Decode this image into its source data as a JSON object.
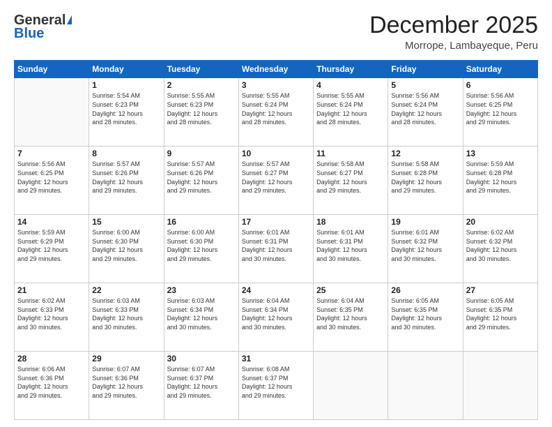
{
  "header": {
    "logo_general": "General",
    "logo_blue": "Blue",
    "title": "December 2025",
    "subtitle": "Morrope, Lambayeque, Peru"
  },
  "days_of_week": [
    "Sunday",
    "Monday",
    "Tuesday",
    "Wednesday",
    "Thursday",
    "Friday",
    "Saturday"
  ],
  "weeks": [
    [
      {
        "day": "",
        "info": ""
      },
      {
        "day": "1",
        "info": "Sunrise: 5:54 AM\nSunset: 6:23 PM\nDaylight: 12 hours\nand 28 minutes."
      },
      {
        "day": "2",
        "info": "Sunrise: 5:55 AM\nSunset: 6:23 PM\nDaylight: 12 hours\nand 28 minutes."
      },
      {
        "day": "3",
        "info": "Sunrise: 5:55 AM\nSunset: 6:24 PM\nDaylight: 12 hours\nand 28 minutes."
      },
      {
        "day": "4",
        "info": "Sunrise: 5:55 AM\nSunset: 6:24 PM\nDaylight: 12 hours\nand 28 minutes."
      },
      {
        "day": "5",
        "info": "Sunrise: 5:56 AM\nSunset: 6:24 PM\nDaylight: 12 hours\nand 28 minutes."
      },
      {
        "day": "6",
        "info": "Sunrise: 5:56 AM\nSunset: 6:25 PM\nDaylight: 12 hours\nand 29 minutes."
      }
    ],
    [
      {
        "day": "7",
        "info": "Sunrise: 5:56 AM\nSunset: 6:25 PM\nDaylight: 12 hours\nand 29 minutes."
      },
      {
        "day": "8",
        "info": "Sunrise: 5:57 AM\nSunset: 6:26 PM\nDaylight: 12 hours\nand 29 minutes."
      },
      {
        "day": "9",
        "info": "Sunrise: 5:57 AM\nSunset: 6:26 PM\nDaylight: 12 hours\nand 29 minutes."
      },
      {
        "day": "10",
        "info": "Sunrise: 5:57 AM\nSunset: 6:27 PM\nDaylight: 12 hours\nand 29 minutes."
      },
      {
        "day": "11",
        "info": "Sunrise: 5:58 AM\nSunset: 6:27 PM\nDaylight: 12 hours\nand 29 minutes."
      },
      {
        "day": "12",
        "info": "Sunrise: 5:58 AM\nSunset: 6:28 PM\nDaylight: 12 hours\nand 29 minutes."
      },
      {
        "day": "13",
        "info": "Sunrise: 5:59 AM\nSunset: 6:28 PM\nDaylight: 12 hours\nand 29 minutes."
      }
    ],
    [
      {
        "day": "14",
        "info": "Sunrise: 5:59 AM\nSunset: 6:29 PM\nDaylight: 12 hours\nand 29 minutes."
      },
      {
        "day": "15",
        "info": "Sunrise: 6:00 AM\nSunset: 6:30 PM\nDaylight: 12 hours\nand 29 minutes."
      },
      {
        "day": "16",
        "info": "Sunrise: 6:00 AM\nSunset: 6:30 PM\nDaylight: 12 hours\nand 29 minutes."
      },
      {
        "day": "17",
        "info": "Sunrise: 6:01 AM\nSunset: 6:31 PM\nDaylight: 12 hours\nand 30 minutes."
      },
      {
        "day": "18",
        "info": "Sunrise: 6:01 AM\nSunset: 6:31 PM\nDaylight: 12 hours\nand 30 minutes."
      },
      {
        "day": "19",
        "info": "Sunrise: 6:01 AM\nSunset: 6:32 PM\nDaylight: 12 hours\nand 30 minutes."
      },
      {
        "day": "20",
        "info": "Sunrise: 6:02 AM\nSunset: 6:32 PM\nDaylight: 12 hours\nand 30 minutes."
      }
    ],
    [
      {
        "day": "21",
        "info": "Sunrise: 6:02 AM\nSunset: 6:33 PM\nDaylight: 12 hours\nand 30 minutes."
      },
      {
        "day": "22",
        "info": "Sunrise: 6:03 AM\nSunset: 6:33 PM\nDaylight: 12 hours\nand 30 minutes."
      },
      {
        "day": "23",
        "info": "Sunrise: 6:03 AM\nSunset: 6:34 PM\nDaylight: 12 hours\nand 30 minutes."
      },
      {
        "day": "24",
        "info": "Sunrise: 6:04 AM\nSunset: 6:34 PM\nDaylight: 12 hours\nand 30 minutes."
      },
      {
        "day": "25",
        "info": "Sunrise: 6:04 AM\nSunset: 6:35 PM\nDaylight: 12 hours\nand 30 minutes."
      },
      {
        "day": "26",
        "info": "Sunrise: 6:05 AM\nSunset: 6:35 PM\nDaylight: 12 hours\nand 30 minutes."
      },
      {
        "day": "27",
        "info": "Sunrise: 6:05 AM\nSunset: 6:35 PM\nDaylight: 12 hours\nand 29 minutes."
      }
    ],
    [
      {
        "day": "28",
        "info": "Sunrise: 6:06 AM\nSunset: 6:36 PM\nDaylight: 12 hours\nand 29 minutes."
      },
      {
        "day": "29",
        "info": "Sunrise: 6:07 AM\nSunset: 6:36 PM\nDaylight: 12 hours\nand 29 minutes."
      },
      {
        "day": "30",
        "info": "Sunrise: 6:07 AM\nSunset: 6:37 PM\nDaylight: 12 hours\nand 29 minutes."
      },
      {
        "day": "31",
        "info": "Sunrise: 6:08 AM\nSunset: 6:37 PM\nDaylight: 12 hours\nand 29 minutes."
      },
      {
        "day": "",
        "info": ""
      },
      {
        "day": "",
        "info": ""
      },
      {
        "day": "",
        "info": ""
      }
    ]
  ]
}
